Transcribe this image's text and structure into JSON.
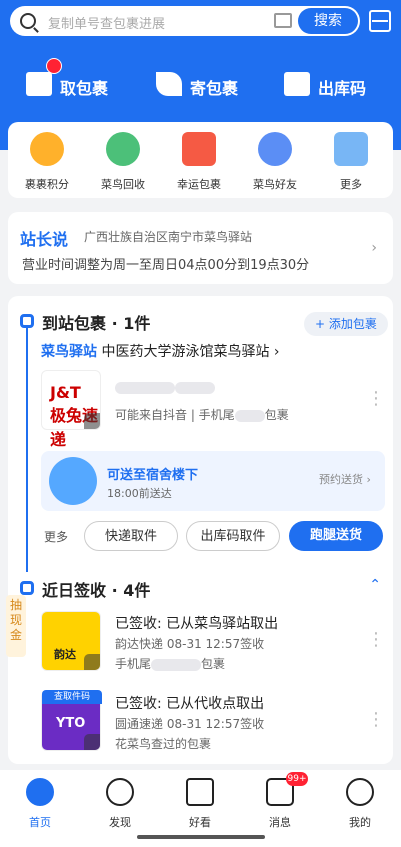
{
  "search": {
    "placeholder": "复制单号查包裹进展",
    "button": "搜索"
  },
  "actions": [
    {
      "label": "取包裹"
    },
    {
      "label": "寄包裹"
    },
    {
      "label": "出库码"
    }
  ],
  "services": [
    {
      "label": "裹裹积分"
    },
    {
      "label": "菜鸟回收"
    },
    {
      "label": "幸运包裹"
    },
    {
      "label": "菜鸟好友"
    },
    {
      "label": "更多"
    }
  ],
  "news": {
    "title": "站长说",
    "subtitle": "广西壮族自治区南宁市菜鸟驿站",
    "content": "营业时间调整为周一至周日04点00分到19点30分"
  },
  "arrived": {
    "title": "到站包裹",
    "count": "1件",
    "add_button": "添加包裹",
    "station_brand": "菜鸟驿站",
    "station_name": "中医药大学游泳馆菜鸟驿站",
    "package": {
      "carrier": "J&T 极兔速递",
      "line1": "可能来自抖音 | 手机尾",
      "line1_suffix": "包裹"
    },
    "delivery": {
      "title": "可送至宿舍楼下",
      "time": "18:00前送达",
      "action": "预约送货"
    },
    "more_label": "更多",
    "buttons": [
      "快递取件",
      "出库码取件",
      "跑腿送货"
    ]
  },
  "recent": {
    "title": "近日签收",
    "count": "4件",
    "items": [
      {
        "status": "已签收: 已从菜鸟驿站取出",
        "carrier": "韵达快递",
        "time": "08-31 12:57签收",
        "desc_prefix": "手机尾",
        "desc_suffix": "包裹",
        "logo": "韵达"
      },
      {
        "status": "已签收: 已从代收点取出",
        "carrier": "圆通速递",
        "time": "08-31 12:57签收",
        "desc_prefix": "花菜鸟查过的包裹",
        "desc_suffix": "",
        "logo": "YTO",
        "badge": "查取件码"
      }
    ]
  },
  "side_tab": "抽现金",
  "tabs": [
    {
      "label": "首页"
    },
    {
      "label": "发现"
    },
    {
      "label": "好看"
    },
    {
      "label": "消息",
      "badge": "99+"
    },
    {
      "label": "我的"
    }
  ],
  "colors": {
    "brand": "#1f6ff0",
    "badge": "#ff2233",
    "header_bg": "#1f6ff0"
  }
}
